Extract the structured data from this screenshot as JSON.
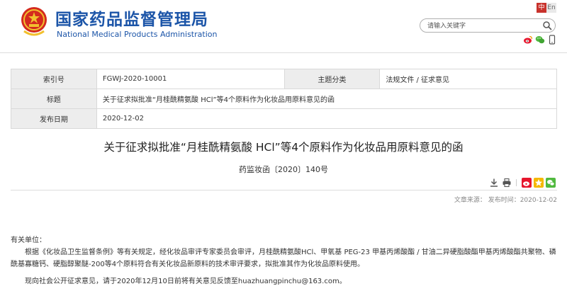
{
  "header": {
    "brand_cn": "国家药品监督管理局",
    "brand_en": "National Medical Products Administration",
    "lang_zh": "中",
    "lang_en": "En",
    "search_placeholder": "请输入关键字",
    "social_icons": [
      "weibo-icon",
      "wechat-icon",
      "mobile-icon"
    ]
  },
  "info": {
    "index_label": "索引号",
    "index_value": "FGWJ-2020-10001",
    "category_label": "主题分类",
    "category_value": "法规文件 / 征求意见",
    "title_label": "标题",
    "title_value": "关于征求拟批准“月桂酰精氨酸 HCl”等4个原料作为化妆品用原料意见的函",
    "date_label": "发布日期",
    "date_value": "2020-12-02"
  },
  "article": {
    "title": "关于征求拟批准“月桂酰精氨酸 HCl”等4个原料作为化妆品用原料意见的函",
    "doc_number": "药监妆函〔2020〕140号",
    "publish_date": "文章来源：  发布时间：2020-12-02",
    "salutation": "有关单位：",
    "paragraph1": "根据《化妆品卫生监督条例》等有关规定，经化妆品审评专家委员会审评，月桂酰精氨酸HCl、甲氧基 PEG-23 甲基丙烯酸酯 / 甘油二异硬脂酸酯甲基丙烯酸酯共聚物、磷酰基寡糖钙、硬脂醇聚醚-200等4个原料符合有关化妆品新原料的技术审评要求，拟批准其作为化妆品原料使用。",
    "paragraph2": "现向社会公开征求意见，请于2020年12月10日前将有关意见反馈至huazhuangpinchu@163.com。"
  },
  "colors": {
    "brand_blue": "#1c55a8",
    "lang_active": "#c8322c",
    "label_bg": "#ededed"
  }
}
